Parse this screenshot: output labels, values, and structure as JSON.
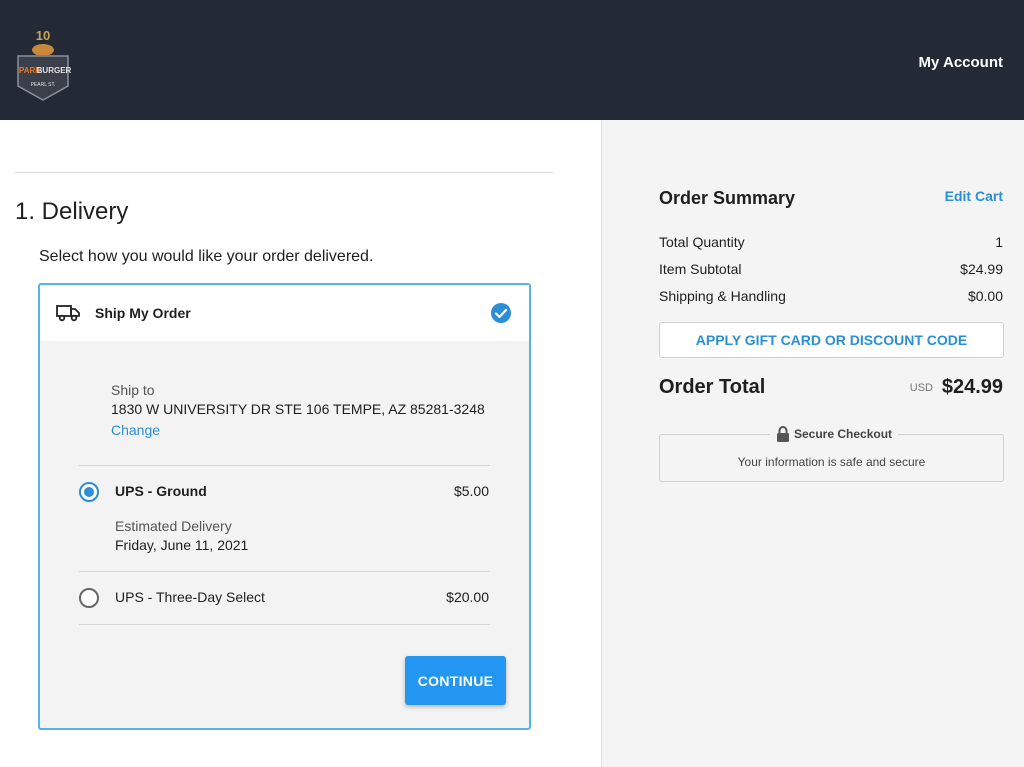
{
  "header": {
    "brand": {
      "word_left": "PARK",
      "word_right": "BURGER",
      "location": "PEARL ST.",
      "badge_number": "10"
    },
    "my_account": "My Account"
  },
  "delivery": {
    "step_title": "1. Delivery",
    "subtitle": "Select how you would like your order delivered.",
    "card_title": "Ship My Order",
    "ship_to_label": "Ship to",
    "ship_to_address": "1830 W UNIVERSITY DR STE 106 TEMPE, AZ 85281-3248",
    "change_label": "Change",
    "options": [
      {
        "name": "UPS - Ground",
        "price": "$5.00",
        "selected": true,
        "estimate_label": "Estimated Delivery",
        "estimate_date": "Friday, June 11, 2021"
      },
      {
        "name": "UPS - Three-Day Select",
        "price": "$20.00",
        "selected": false
      }
    ],
    "continue_label": "CONTINUE"
  },
  "summary": {
    "title": "Order Summary",
    "edit_cart": "Edit Cart",
    "rows": [
      {
        "label": "Total Quantity",
        "value": "1"
      },
      {
        "label": "Item Subtotal",
        "value": "$24.99"
      },
      {
        "label": "Shipping & Handling",
        "value": "$0.00"
      }
    ],
    "gift_button": "APPLY GIFT CARD OR DISCOUNT CODE",
    "total_label": "Order Total",
    "total_currency": "USD",
    "total_value": "$24.99",
    "secure_title": "Secure Checkout",
    "secure_text": "Your information is safe and secure"
  },
  "colors": {
    "header_bg": "#232a36",
    "accent": "#2296f0",
    "link": "#2b8fd6",
    "panel_bg": "#f4f4f4"
  }
}
